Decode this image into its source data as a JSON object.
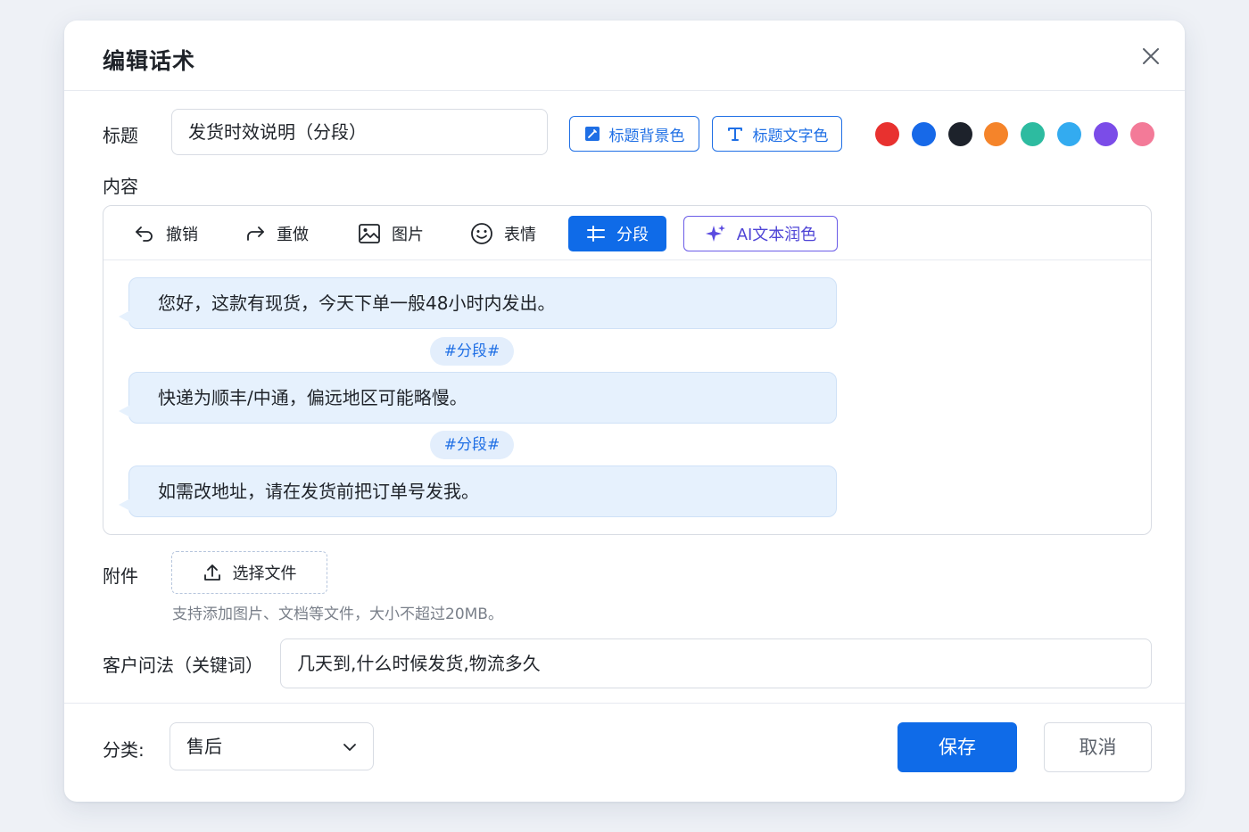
{
  "dialog": {
    "title": "编辑话术"
  },
  "form": {
    "title_label": "标题",
    "title_value": "发货时效说明（分段）",
    "title_bg_button": "标题背景色",
    "title_text_button": "标题文字色",
    "swatches": [
      "#e8312f",
      "#1769e8",
      "#1d222b",
      "#f5842a",
      "#2dbba0",
      "#33abf0",
      "#7b4ce8",
      "#f37a98"
    ],
    "content_label": "内容",
    "attachment_label": "附件",
    "upload_label": "选择文件",
    "upload_hint": "支持添加图片、文档等文件，大小不超过20MB。",
    "keyword_label": "客户问法（关键词）",
    "keyword_value": "几天到,什么时候发货,物流多久"
  },
  "toolbar": {
    "undo": "撤销",
    "redo": "重做",
    "image": "图片",
    "emoji": "表情",
    "segment": "分段",
    "ai": "AI文本润色"
  },
  "messages": [
    "您好，这款有现货，今天下单一般48小时内发出。",
    "快递为顺丰/中通，偏远地区可能略慢。",
    "如需改地址，请在发货前把订单号发我。"
  ],
  "segment_tag": "#分段#",
  "footer": {
    "category_label": "分类:",
    "category_value": "售后",
    "save": "保存",
    "cancel": "取消"
  },
  "colors": {
    "primary": "#0f6be8",
    "ai_accent": "#6b5ce7",
    "bubble": "#e6f1fd"
  }
}
